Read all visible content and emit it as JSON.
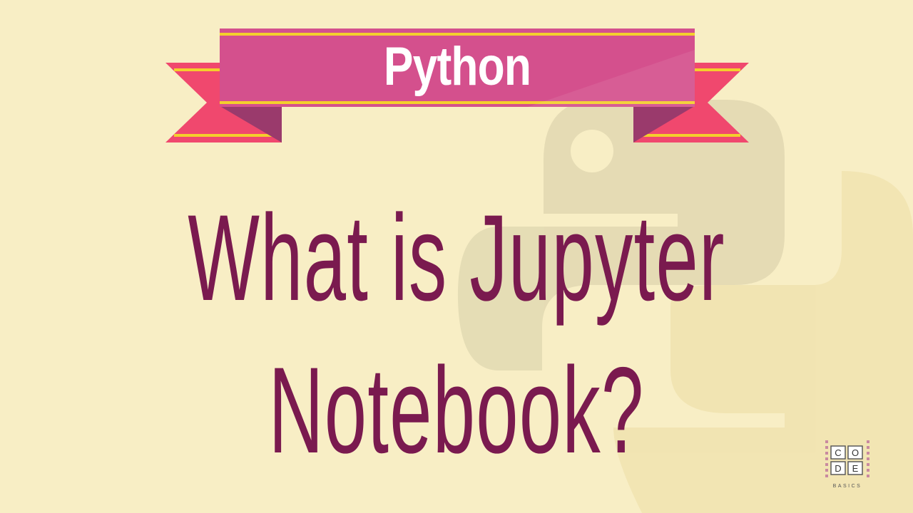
{
  "banner": {
    "label": "Python"
  },
  "title": {
    "line1": "What is Jupyter",
    "line2": "Notebook?"
  },
  "logo": {
    "letters": [
      "C",
      "O",
      "D",
      "E"
    ],
    "subtitle": "BASICS"
  },
  "colors": {
    "background": "#f8eec5",
    "ribbon_main": "#d4508d",
    "ribbon_ends": "#f0486e",
    "ribbon_fold": "#9a3a6c",
    "ribbon_stripe": "#f4cf2c",
    "title_text": "#7a1a4f",
    "watermark": "#e5dcb3"
  },
  "icons": {
    "watermark": "python-logo-icon"
  }
}
